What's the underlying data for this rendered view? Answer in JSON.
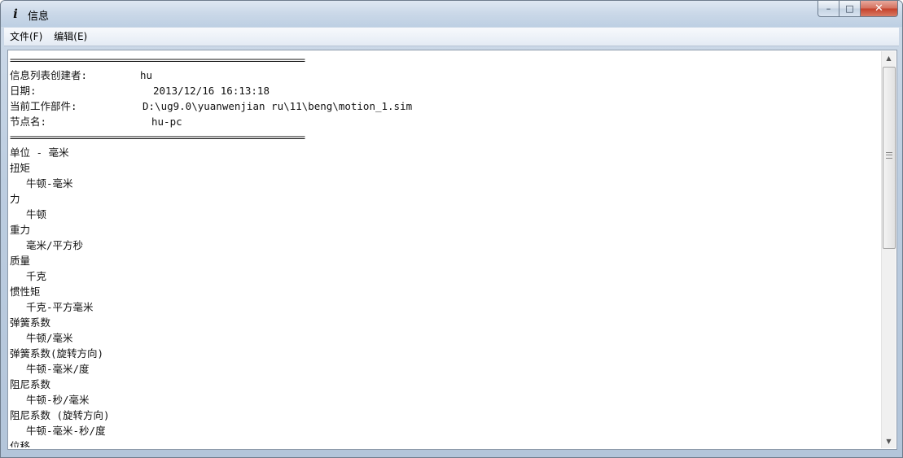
{
  "window": {
    "title": "信息",
    "icon": "info-icon",
    "caption_buttons": {
      "minimize": "–",
      "maximize": "□",
      "close": "✕"
    }
  },
  "menu": [
    {
      "label": "文件(F)"
    },
    {
      "label": "编辑(E)"
    }
  ],
  "content": {
    "separator": "=============================================================",
    "header": {
      "creator_label": "信息列表创建者:",
      "creator_value": "hu",
      "date_label": "日期:",
      "date_value": "2013/12/16 16:13:18",
      "part_label": "当前工作部件:",
      "part_value": "D:\\ug9.0\\yuanwenjian ru\\11\\beng\\motion_1.sim",
      "node_label": "节点名:",
      "node_value": "hu-pc"
    },
    "units_title": "单位 - 毫米",
    "units": [
      {
        "name": "扭矩",
        "unit": "牛顿-毫米"
      },
      {
        "name": "力",
        "unit": "牛顿"
      },
      {
        "name": "重力",
        "unit": "毫米/平方秒"
      },
      {
        "name": "质量",
        "unit": "千克"
      },
      {
        "name": "惯性矩",
        "unit": "千克-平方毫米"
      },
      {
        "name": "弹簧系数",
        "unit": "牛顿/毫米"
      },
      {
        "name": "弹簧系数(旋转方向)",
        "unit": "牛顿-毫米/度"
      },
      {
        "name": "阻尼系数",
        "unit": "牛顿-秒/毫米"
      },
      {
        "name": "阻尼系数 (旋转方向)",
        "unit": "牛顿-毫米-秒/度"
      }
    ],
    "last_line": "位移"
  }
}
